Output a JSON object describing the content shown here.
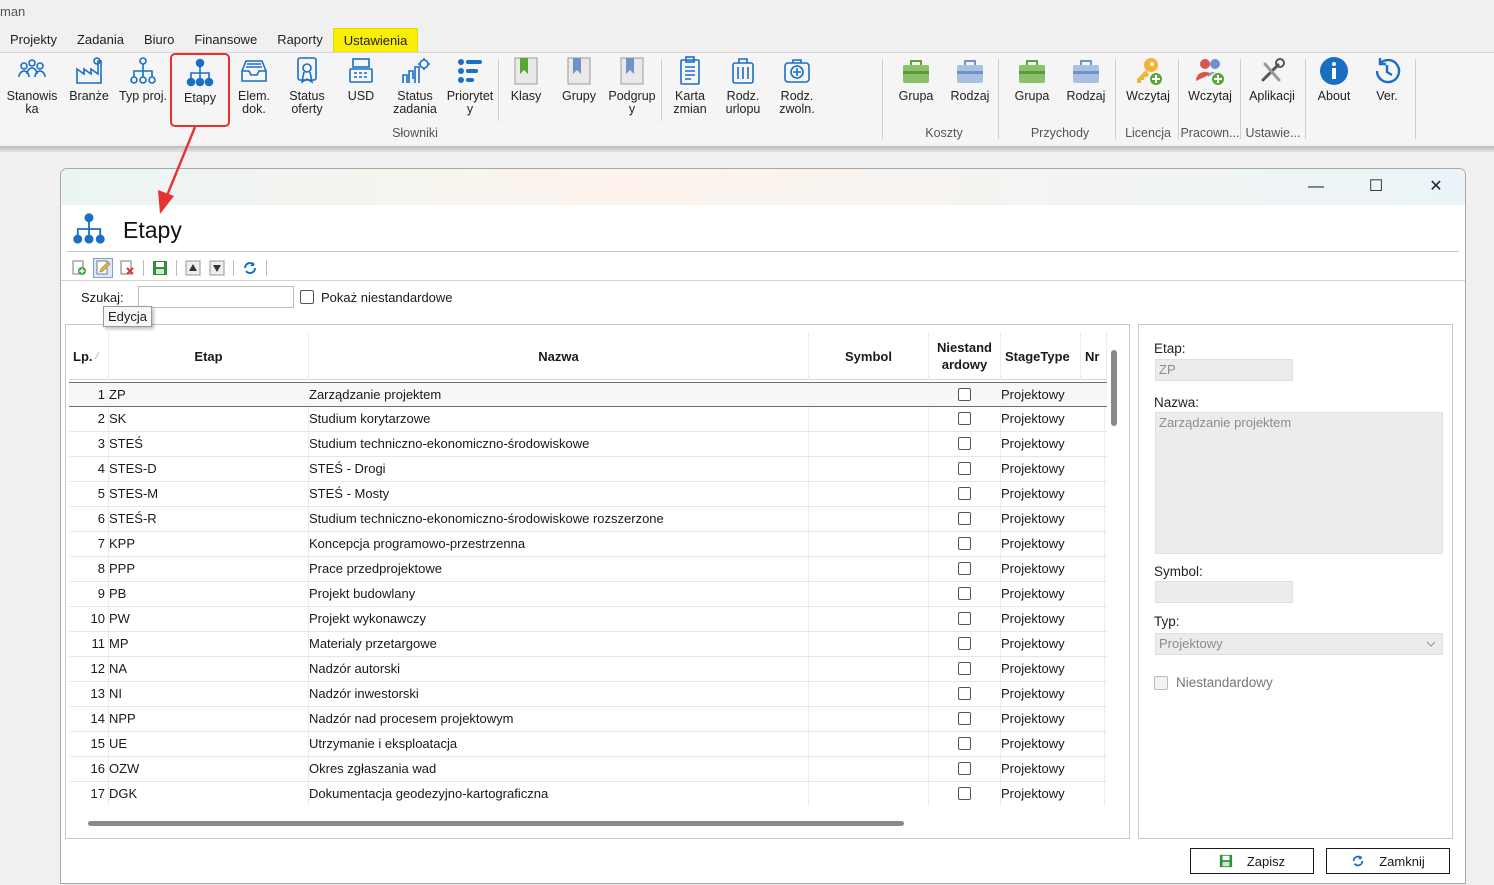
{
  "app": {
    "title": "man"
  },
  "menu": [
    {
      "label": "Projekty"
    },
    {
      "label": "Zadania"
    },
    {
      "label": "Biuro"
    },
    {
      "label": "Finansowe"
    },
    {
      "label": "Raporty"
    },
    {
      "label": "Ustawienia",
      "active": true
    }
  ],
  "ribbon": {
    "buttons": {
      "stanowiska": "Stanowis\nka",
      "branze": "Branże",
      "typ_proj": "Typ proj.",
      "etapy": "Etapy",
      "elem_dok": "Elem.\ndok.",
      "status_oferty": "Status\noferty",
      "usd": "USD",
      "status_zadania": "Status\nzadania",
      "priorytety": "Priorytet\ny",
      "klasy": "Klasy",
      "grupy": "Grupy",
      "podgrupy": "Podgrup\ny",
      "karta_zmian": "Karta\nzmian",
      "rodz_urlopu": "Rodz.\nurlopu",
      "rodz_zwoln": "Rodz.\nzwoln.",
      "koszty_grupa": "Grupa",
      "koszty_rodzaj": "Rodzaj",
      "przychody_grupa": "Grupa",
      "przychody_rodzaj": "Rodzaj",
      "licencja_wczytaj": "Wczytaj",
      "pracown_wczytaj": "Wczytaj",
      "aplikacji": "Aplikacji",
      "about": "About",
      "ver": "Ver."
    },
    "groups": {
      "slowniki": "Słowniki",
      "koszty": "Koszty",
      "przychody": "Przychody",
      "licencja": "Licencja",
      "pracown": "Pracown...",
      "ustawie": "Ustawie..."
    }
  },
  "window": {
    "controls": {
      "minimize": "—",
      "maximize": "☐",
      "close": "✕"
    },
    "title": "Etapy",
    "search_label": "Szukaj:",
    "search_value": "",
    "show_nonstandard_label": "Pokaż niestandardowe",
    "tooltip": "Edycja"
  },
  "grid": {
    "columns": {
      "lp": "Lp.",
      "etap": "Etap",
      "nazwa": "Nazwa",
      "symbol": "Symbol",
      "niestandardowy": "Niestand\nardowy",
      "stagetype": "StageType",
      "nr": "Nr"
    },
    "rows": [
      {
        "lp": "1",
        "etap": "ZP",
        "nazwa": "Zarządzanie projektem",
        "symbol": "",
        "stagetype": "Projektowy"
      },
      {
        "lp": "2",
        "etap": "SK",
        "nazwa": "Studium korytarzowe",
        "symbol": "",
        "stagetype": "Projektowy"
      },
      {
        "lp": "3",
        "etap": "STEŚ",
        "nazwa": "Studium  techniczno-ekonomiczno-środowiskowe",
        "symbol": "",
        "stagetype": "Projektowy"
      },
      {
        "lp": "4",
        "etap": "STES-D",
        "nazwa": "STEŚ - Drogi",
        "symbol": "",
        "stagetype": "Projektowy"
      },
      {
        "lp": "5",
        "etap": "STES-M",
        "nazwa": "STEŚ - Mosty",
        "symbol": "",
        "stagetype": "Projektowy"
      },
      {
        "lp": "6",
        "etap": "STEŚ-R",
        "nazwa": "Studium  techniczno-ekonomiczno-środowiskowe  rozszerzone",
        "symbol": "",
        "stagetype": "Projektowy"
      },
      {
        "lp": "7",
        "etap": "KPP",
        "nazwa": "Koncepcja  programowo-przestrzenna",
        "symbol": "",
        "stagetype": "Projektowy"
      },
      {
        "lp": "8",
        "etap": "PPP",
        "nazwa": "Prace przedprojektowe",
        "symbol": "",
        "stagetype": "Projektowy"
      },
      {
        "lp": "9",
        "etap": "PB",
        "nazwa": "Projekt budowlany",
        "symbol": "",
        "stagetype": "Projektowy"
      },
      {
        "lp": "10",
        "etap": "PW",
        "nazwa": "Projekt wykonawczy",
        "symbol": "",
        "stagetype": "Projektowy"
      },
      {
        "lp": "11",
        "etap": "MP",
        "nazwa": "Materialy przetargowe",
        "symbol": "",
        "stagetype": "Projektowy"
      },
      {
        "lp": "12",
        "etap": "NA",
        "nazwa": "Nadzór autorski",
        "symbol": "",
        "stagetype": "Projektowy"
      },
      {
        "lp": "13",
        "etap": "NI",
        "nazwa": "Nadzór inwestorski",
        "symbol": "",
        "stagetype": "Projektowy"
      },
      {
        "lp": "14",
        "etap": "NPP",
        "nazwa": "Nadzór nad procesem projektowym",
        "symbol": "",
        "stagetype": "Projektowy"
      },
      {
        "lp": "15",
        "etap": "UE",
        "nazwa": "Utrzymanie i eksploatacja",
        "symbol": "",
        "stagetype": "Projektowy"
      },
      {
        "lp": "16",
        "etap": "OZW",
        "nazwa": "Okres zgłaszania wad",
        "symbol": "",
        "stagetype": "Projektowy"
      },
      {
        "lp": "17",
        "etap": "DGK",
        "nazwa": "Dokumentacja  geodezyjno-kartograficzna",
        "symbol": "",
        "stagetype": "Projektowy"
      }
    ]
  },
  "detail": {
    "etap_label": "Etap:",
    "etap_value": "ZP",
    "nazwa_label": "Nazwa:",
    "nazwa_value": "Zarządzanie projektem",
    "symbol_label": "Symbol:",
    "symbol_value": "",
    "typ_label": "Typ:",
    "typ_value": "Projektowy",
    "niestandardowy_label": "Niestandardowy"
  },
  "footer": {
    "save": "Zapisz",
    "close": "Zamknij"
  },
  "colors": {
    "active_tab": "#f9ef06",
    "highlight_red": "#e63232",
    "icon_blue": "#1a6fc4"
  }
}
